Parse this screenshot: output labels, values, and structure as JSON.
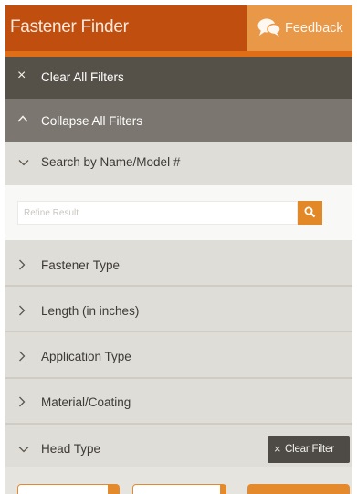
{
  "header": {
    "title": "Fastener Finder",
    "feedback_label": "Feedback",
    "feedback_icon": "chat-bubbles-icon"
  },
  "filter_actions": {
    "clear_all": "Clear All Filters",
    "collapse_all": "Collapse All Filters"
  },
  "search": {
    "section_label": "Search by Name/Model #",
    "placeholder": "Refine Result",
    "value": ""
  },
  "sections": [
    {
      "label": "Fastener Type",
      "expanded": false
    },
    {
      "label": "Length (in inches)",
      "expanded": false
    },
    {
      "label": "Application Type",
      "expanded": false
    },
    {
      "label": "Material/Coating",
      "expanded": false
    },
    {
      "label": "Head Type",
      "expanded": true
    }
  ],
  "head_type": {
    "clear_filter_label": "Clear Filter"
  },
  "colors": {
    "brand": "#c04f0f",
    "accent": "#e38827",
    "dark_row": "#565148",
    "medium_row": "#7b766f",
    "panel_bg": "#dfddd7"
  }
}
